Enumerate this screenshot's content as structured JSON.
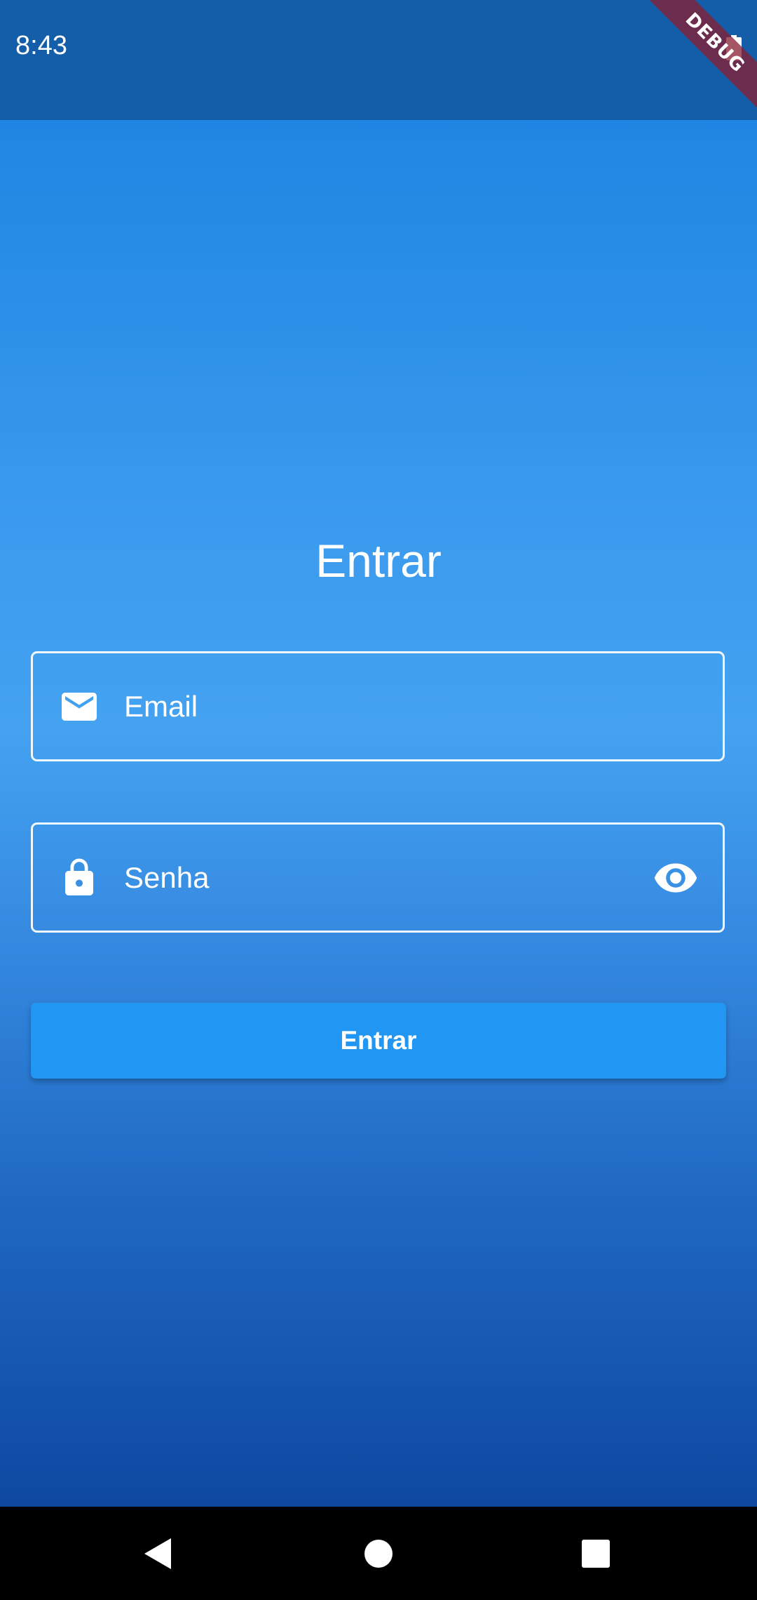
{
  "status_bar": {
    "time": "8:43",
    "battery_icon": "battery-full-icon"
  },
  "debug_banner": {
    "label": "DEBUG"
  },
  "login": {
    "title": "Entrar",
    "email_field": {
      "placeholder": "Email",
      "value": "",
      "icon": "mail-icon"
    },
    "password_field": {
      "placeholder": "Senha",
      "value": "",
      "icon": "lock-icon",
      "toggle_icon": "eye-icon"
    },
    "submit_label": "Entrar"
  },
  "nav_bar": {
    "back_icon": "back-triangle-icon",
    "home_icon": "home-circle-icon",
    "recents_icon": "recents-square-icon"
  },
  "colors": {
    "status_bar": "#145da8",
    "gradient_top": "#1e86e2",
    "gradient_mid": "#44a2f1",
    "gradient_bottom": "#0e48a1",
    "button": "#2196f3",
    "text": "#ffffff",
    "nav_bar": "#000000"
  }
}
